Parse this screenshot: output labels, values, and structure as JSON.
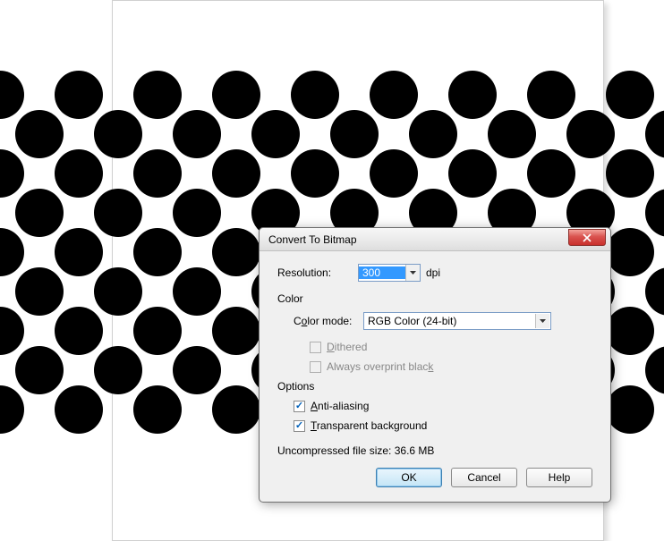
{
  "dialog": {
    "title": "Convert To Bitmap",
    "resolution": {
      "label": "Resolution:",
      "value": "300",
      "unit": "dpi"
    },
    "color": {
      "group_label": "Color",
      "mode_label_pre": "C",
      "mode_label_accel": "o",
      "mode_label_post": "lor mode:",
      "mode_value": "RGB Color (24-bit)",
      "dithered_pre": "",
      "dithered_accel": "D",
      "dithered_post": "ithered",
      "overprint_pre": "Always overprint blac",
      "overprint_accel": "k",
      "overprint_post": ""
    },
    "options": {
      "group_label": "Options",
      "aa_pre": "",
      "aa_accel": "A",
      "aa_post": "nti-aliasing",
      "aa_checked": true,
      "tb_pre": "",
      "tb_accel": "T",
      "tb_post": "ransparent background",
      "tb_checked": true
    },
    "filesize_label": "Uncompressed file size:",
    "filesize_value": "36.6 MB",
    "buttons": {
      "ok": "OK",
      "cancel": "Cancel",
      "help": "Help"
    }
  }
}
